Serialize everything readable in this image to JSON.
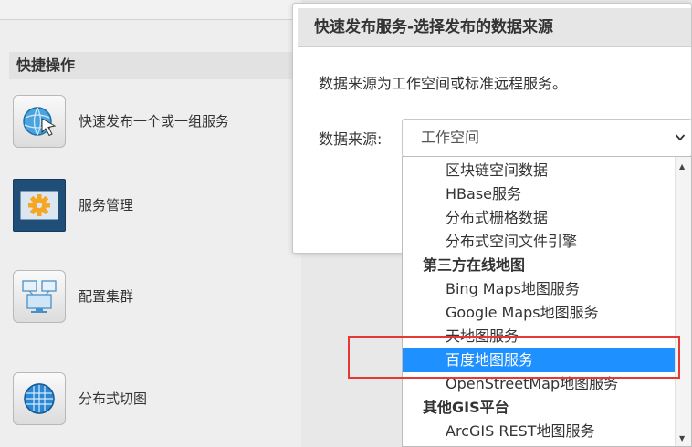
{
  "quick_actions": {
    "title": "快捷操作",
    "items": [
      {
        "label": "快速发布一个或一组服务",
        "icon": "globe-cursor-icon"
      },
      {
        "label": "服务管理",
        "icon": "gear-icon"
      },
      {
        "label": "配置集群",
        "icon": "cluster-icon"
      },
      {
        "label": "分布式切图",
        "icon": "globe-grid-icon"
      }
    ]
  },
  "dialog": {
    "title": "快速发布服务-选择发布的数据来源",
    "description": "数据来源为工作空间或标准远程服务。",
    "source_label": "数据来源:",
    "selected_value": "工作空间"
  },
  "dropdown": {
    "items": [
      {
        "label": "区块链空间数据",
        "type": "option"
      },
      {
        "label": "HBase服务",
        "type": "option"
      },
      {
        "label": "分布式栅格数据",
        "type": "option"
      },
      {
        "label": "分布式空间文件引擎",
        "type": "option"
      },
      {
        "label": "第三方在线地图",
        "type": "group"
      },
      {
        "label": "Bing Maps地图服务",
        "type": "option"
      },
      {
        "label": "Google Maps地图服务",
        "type": "option"
      },
      {
        "label": "天地图服务",
        "type": "option"
      },
      {
        "label": "百度地图服务",
        "type": "option",
        "selected": true
      },
      {
        "label": "OpenStreetMap地图服务",
        "type": "option"
      },
      {
        "label": "其他GIS平台",
        "type": "group"
      },
      {
        "label": "ArcGIS REST地图服务",
        "type": "option"
      }
    ]
  },
  "colors": {
    "selection": "#1e90ff",
    "highlight_border": "#e53935"
  }
}
